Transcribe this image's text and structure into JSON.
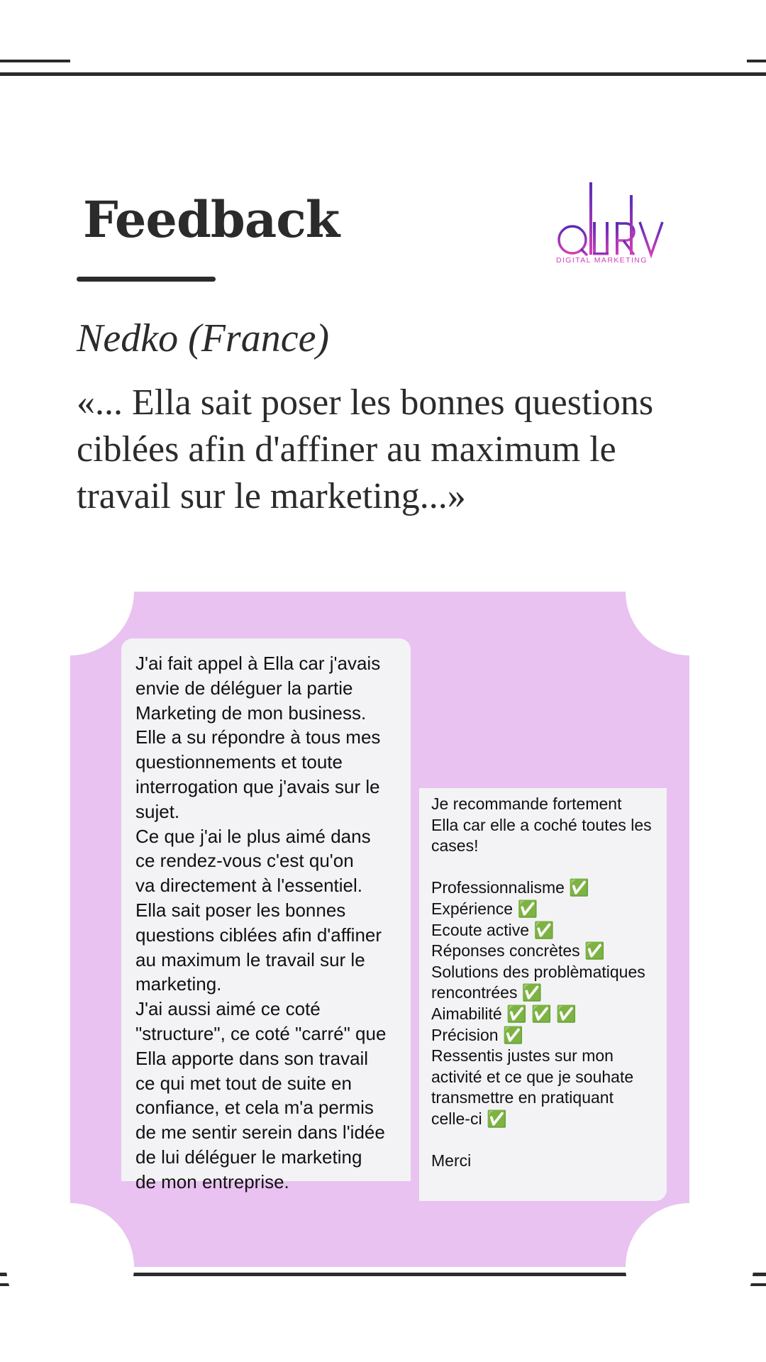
{
  "header": {
    "title": "Feedback",
    "logo_text": "QURV",
    "logo_subtext": "DIGITAL MARKETING"
  },
  "testimonial": {
    "author": "Nedko (France)",
    "quote": "«... Ella sait poser les bonnes questions ciblées afin d'affiner au maximum le travail sur le marketing...»"
  },
  "messages": {
    "left": "J'ai fait appel à Ella car j'avais\nenvie de déléguer la partie\nMarketing de mon business.\nElle a su répondre à tous mes\nquestionnements et toute\ninterrogation que j'avais sur le\nsujet.\nCe que j'ai le plus aimé dans\nce rendez-vous c'est qu'on\nva directement à l'essentiel.\nElla sait poser les bonnes\nquestions ciblées afin d'affiner\nau maximum le travail sur le\nmarketing.\nJ'ai aussi aimé ce coté\n\"structure\", ce coté \"carré\" que\nElla apporte dans son travail\nce qui met tout de suite en\nconfiance, et cela m'a permis\nde me sentir serein dans l'idée\nde lui déléguer le marketing\nde mon entreprise.",
    "right": "Je recommande fortement\nElla car elle a coché toutes les\ncases!\n\nProfessionnalisme ✅\nExpérience ✅\nEcoute active ✅\nRéponses concrètes ✅\nSolutions des problèmatiques\nrencontrées ✅\nAimabilité ✅ ✅ ✅\nPrécision ✅\nRessentis justes sur mon\nactivité et ce que je souhate\ntransmettre en pratiquant\ncelle-ci ✅\n\nMerci"
  },
  "colors": {
    "card_background": "#e9c2f1",
    "bubble_background": "#f3f3f5",
    "text_dark": "#2b2b2b",
    "logo_purple": "#7a2fc4",
    "logo_pink": "#d23fb8"
  }
}
